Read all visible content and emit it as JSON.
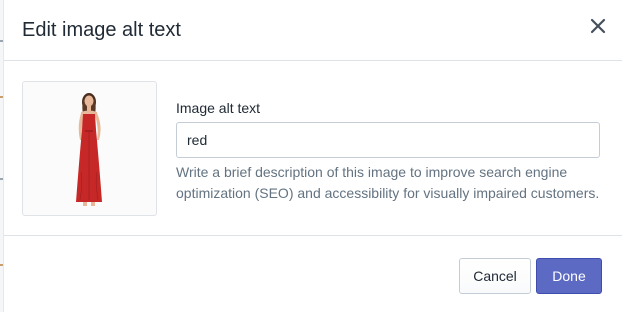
{
  "modal": {
    "title": "Edit image alt text",
    "close_icon": "close-icon"
  },
  "image": {
    "icon": "product-photo-red-dress",
    "dress_color": "#c62828"
  },
  "form": {
    "label": "Image alt text",
    "value": "red",
    "help_text": "Write a brief description of this image to improve search engine optimization (SEO) and accessibility for visually impaired customers."
  },
  "footer": {
    "cancel_label": "Cancel",
    "done_label": "Done"
  },
  "colors": {
    "primary": "#5c6ac4",
    "border": "#dfe3e8",
    "help_text": "#637381"
  }
}
